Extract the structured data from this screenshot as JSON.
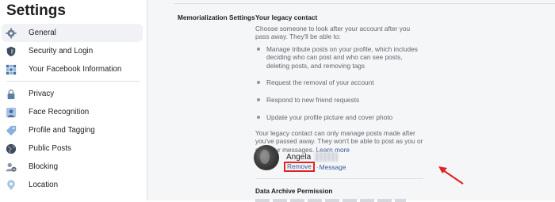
{
  "sidebar": {
    "title": "Settings",
    "items": [
      {
        "label": "General",
        "icon": "gear-icon",
        "active": true
      },
      {
        "label": "Security and Login",
        "icon": "shield-icon"
      },
      {
        "label": "Your Facebook Information",
        "icon": "facebook-grid-icon"
      },
      {
        "label": "Privacy",
        "icon": "lock-icon"
      },
      {
        "label": "Face Recognition",
        "icon": "face-icon"
      },
      {
        "label": "Profile and Tagging",
        "icon": "tag-icon"
      },
      {
        "label": "Public Posts",
        "icon": "globe-icon"
      },
      {
        "label": "Blocking",
        "icon": "block-user-icon"
      },
      {
        "label": "Location",
        "icon": "location-pin-icon"
      }
    ]
  },
  "main": {
    "row_label": "Memorialization Settings",
    "section_title": "Your legacy contact",
    "intro": "Choose someone to look after your account after you pass away. They'll be able to:",
    "bullets": [
      "Manage tribute posts on your profile, which includes deciding who can post and who can see posts, deleting posts, and removing tags",
      "Request the removal of your account",
      "Respond to new friend requests",
      "Update your profile picture and cover photo"
    ],
    "note": "Your legacy contact can only manage posts made after you've passed away. They won't be able to post as you or see your messages.",
    "learn_more": "Learn more",
    "contact": {
      "name": "Angela",
      "remove_label": "Remove",
      "separator": "·",
      "message_label": "Message"
    },
    "next_section_title": "Data Archive Permission"
  },
  "colors": {
    "link": "#385898",
    "highlight_box": "#e02424",
    "active_nav_bg": "#f0f2f5",
    "main_bg": "#f5f6f7"
  }
}
